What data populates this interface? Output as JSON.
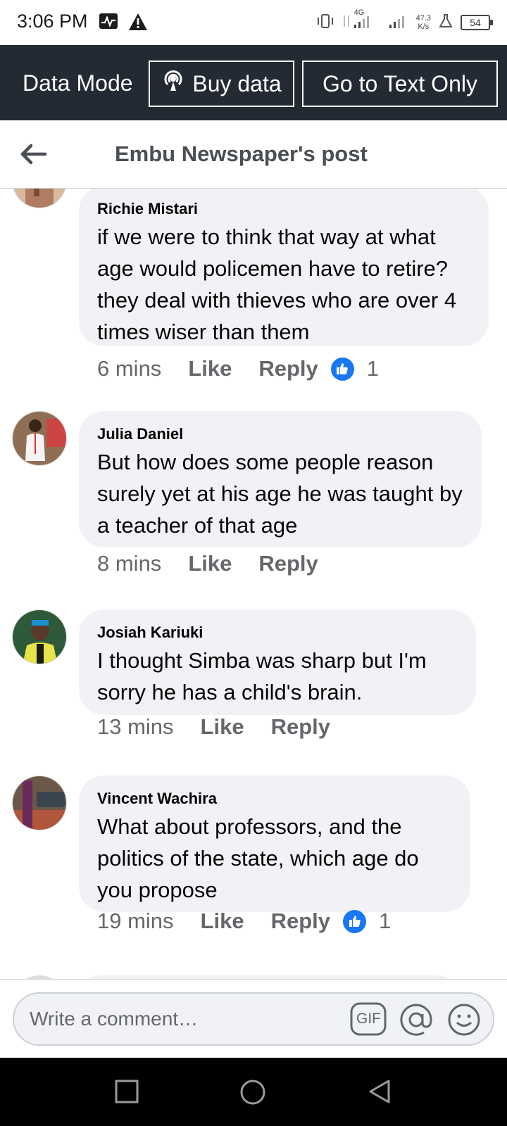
{
  "status_bar": {
    "time": "3:06 PM",
    "network_type": "4G",
    "speed_value": "47.3",
    "speed_unit": "K/s",
    "battery": "54",
    "icons": [
      "activity-icon",
      "warning-icon",
      "vibrate-icon",
      "signal-icon",
      "signal-icon",
      "flask-icon",
      "battery-icon"
    ]
  },
  "data_bar": {
    "label": "Data Mode",
    "buy_data": "Buy data",
    "text_only": "Go to Text Only"
  },
  "header": {
    "title": "Embu Newspaper's post"
  },
  "comments": [
    {
      "author": "Richie Mistari",
      "text": "if we were to think that way at what age would policemen have to retire? they deal with thieves who are over 4 times wiser than them",
      "time": "6 mins",
      "like": "Like",
      "reply": "Reply",
      "reactions": "1"
    },
    {
      "author": "Julia Daniel",
      "text": "But how does some people reason surely yet at his age he was taught by a teacher of that age",
      "time": "8 mins",
      "like": "Like",
      "reply": "Reply",
      "reactions": ""
    },
    {
      "author": "Josiah Kariuki",
      "text": "I thought Simba was sharp but I'm sorry he has a child's brain.",
      "time": "13 mins",
      "like": "Like",
      "reply": "Reply",
      "reactions": ""
    },
    {
      "author": "Vincent Wachira",
      "text": "What about professors, and the politics of the state, which age do you propose",
      "time": "19 mins",
      "like": "Like",
      "reply": "Reply",
      "reactions": "1"
    }
  ],
  "composer": {
    "placeholder": "Write a comment…",
    "gif_label": "GIF"
  },
  "colors": {
    "data_bar_bg": "#232a33",
    "bubble_bg": "#f0f2f5",
    "like_blue": "#1877f2",
    "meta_gray": "#65676b"
  }
}
